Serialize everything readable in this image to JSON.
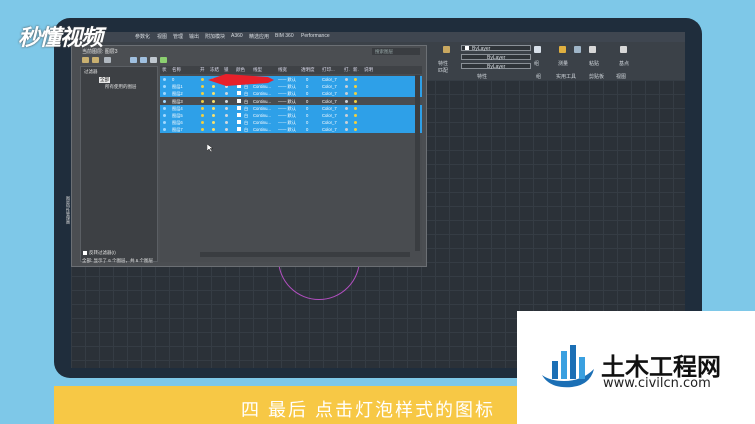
{
  "logo": {
    "text": "秒懂视频"
  },
  "ribbon": {
    "tabs": [
      "参数化",
      "视图",
      "管理",
      "输出",
      "附加模块",
      "A360",
      "精选应用",
      "BIM 360",
      "Performance"
    ],
    "layer_dropdown": "ByLayer",
    "linetype_1": "ByLayer",
    "linetype_2": "ByLayer",
    "groups": [
      "特性",
      "组",
      "实用工具",
      "剪贴板",
      "视图"
    ],
    "labels": [
      "特性",
      "匹配",
      "组",
      "测量",
      "粘贴",
      "基点"
    ]
  },
  "layer_panel": {
    "title": "当前图层: 图层3",
    "search_placeholder": "搜索图层",
    "tree": {
      "header": "过滤器",
      "all": "全部",
      "used": "所有使用的图层"
    },
    "invert_filter": "反转过滤器(I)",
    "side_tab": "图层特性管理器",
    "status": "全部: 显示了 6 个图层，共 6 个图层",
    "columns": [
      "状",
      "名称",
      "开",
      "冻结",
      "锁",
      "颜色",
      "线型",
      "线宽",
      "透明度",
      "打印...",
      "打.",
      "新.",
      "说明"
    ],
    "rows": [
      {
        "name": "0",
        "color": "白",
        "linetype": "Continu...",
        "lineweight": "—— 默认",
        "transparency": "0",
        "plot": "Color_7",
        "selected": true
      },
      {
        "name": "图层1",
        "color": "白",
        "linetype": "Continu...",
        "lineweight": "—— 默认",
        "transparency": "0",
        "plot": "Color_7",
        "selected": true
      },
      {
        "name": "图层2",
        "color": "白",
        "linetype": "Continu...",
        "lineweight": "—— 默认",
        "transparency": "0",
        "plot": "Color_7",
        "selected": true
      },
      {
        "name": "图层3",
        "color": "白",
        "linetype": "Continu...",
        "lineweight": "—— 默认",
        "transparency": "0",
        "plot": "Color_7",
        "selected": false
      },
      {
        "name": "图层4",
        "color": "白",
        "linetype": "Continu...",
        "lineweight": "—— 默认",
        "transparency": "0",
        "plot": "Color_7",
        "selected": true
      },
      {
        "name": "图层5",
        "color": "白",
        "linetype": "Continu...",
        "lineweight": "—— 默认",
        "transparency": "0",
        "plot": "Color_7",
        "selected": true
      },
      {
        "name": "图层6",
        "color": "白",
        "linetype": "Continu...",
        "lineweight": "—— 默认",
        "transparency": "0",
        "plot": "Color_7",
        "selected": true
      },
      {
        "name": "图层7",
        "color": "白",
        "linetype": "Continu...",
        "lineweight": "—— 默认",
        "transparency": "0",
        "plot": "Color_7",
        "selected": true
      }
    ]
  },
  "subtitle": "四 最后 点击灯泡样式的图标",
  "watermark": {
    "title": "土木工程网",
    "url": "www.civilcn.com"
  },
  "colors": {
    "selection": "#2ea0e8",
    "bulb": "#f0d040",
    "subtitle_band": "#f7c845",
    "circle": "#b24fc0",
    "red_marker": "#e8202a"
  }
}
